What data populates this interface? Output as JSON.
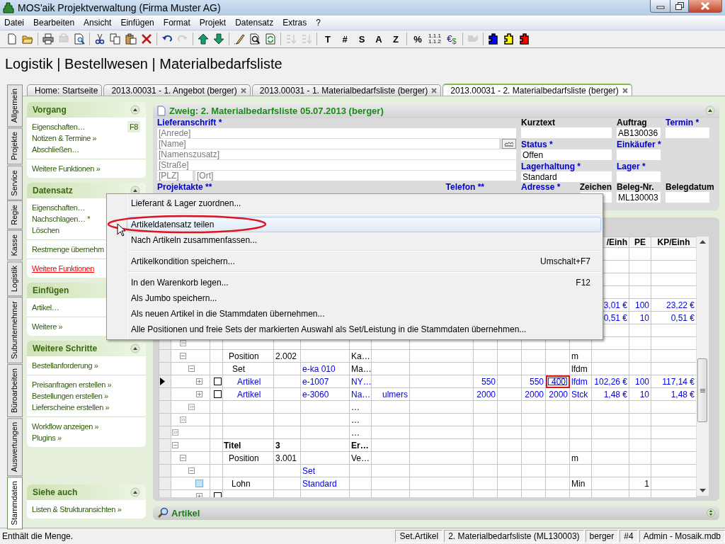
{
  "window": {
    "title": "MOS'aik Projektverwaltung (Firma Muster AG)"
  },
  "menu": [
    "Datei",
    "Bearbeiten",
    "Ansicht",
    "Einfügen",
    "Format",
    "Projekt",
    "Datensatz",
    "Extras",
    "?"
  ],
  "toolbar": [
    [
      {
        "kind": "icon",
        "disabled": false
      },
      {
        "kind": "icon",
        "disabled": false
      }
    ],
    [
      {
        "kind": "icon",
        "disabled": false
      },
      {
        "kind": "icon",
        "disabled": true
      },
      {
        "kind": "icon",
        "disabled": false
      }
    ],
    [
      {
        "kind": "icon",
        "disabled": false
      },
      {
        "kind": "icon",
        "disabled": false
      },
      {
        "kind": "icon",
        "disabled": false
      },
      {
        "kind": "icon",
        "disabled": false
      }
    ],
    [
      {
        "kind": "icon",
        "disabled": false
      },
      {
        "kind": "icon",
        "disabled": true
      }
    ],
    [
      {
        "kind": "icon",
        "disabled": false
      },
      {
        "kind": "icon",
        "disabled": false
      }
    ],
    [
      {
        "kind": "icon",
        "disabled": false
      },
      {
        "kind": "icon",
        "disabled": false
      },
      {
        "kind": "icon",
        "disabled": false
      }
    ],
    [
      {
        "kind": "icon",
        "disabled": true
      },
      {
        "kind": "icon",
        "disabled": true
      }
    ],
    [
      {
        "kind": "text",
        "label": "T"
      },
      {
        "kind": "text",
        "label": "#"
      },
      {
        "kind": "text",
        "label": "S"
      },
      {
        "kind": "text",
        "label": "A"
      },
      {
        "kind": "text",
        "label": "Z"
      }
    ],
    [
      {
        "kind": "text",
        "label": "%"
      },
      {
        "kind": "numbering",
        "lines": [
          "1.1.1",
          "1.1.2"
        ]
      },
      {
        "kind": "currency",
        "symbols": [
          "€",
          "$"
        ]
      }
    ],
    [
      {
        "kind": "icon",
        "disabled": true
      }
    ],
    [
      {
        "kind": "puzzle",
        "color": "#0000ff"
      },
      {
        "kind": "puzzle",
        "color": "#ffff00"
      },
      {
        "kind": "puzzle",
        "color": "#ff0000"
      }
    ]
  ],
  "breadcrumb": "Logistik | Bestellwesen | Materialbedarfsliste",
  "vertical_tabs": [
    {
      "label": "Allgemein",
      "selected": false
    },
    {
      "label": "Projekte",
      "selected": false
    },
    {
      "label": "Service",
      "selected": false
    },
    {
      "label": "Regie",
      "selected": false
    },
    {
      "label": "Kasse",
      "selected": false
    },
    {
      "label": "Logistik",
      "selected": false
    },
    {
      "label": "Subunternehmer",
      "selected": false
    },
    {
      "label": "Büroarbeiten",
      "selected": false
    },
    {
      "label": "Auswertungen",
      "selected": false
    },
    {
      "label": "Stammdaten",
      "selected": true
    }
  ],
  "document_tabs": [
    {
      "label": "Home: Startseite",
      "closable": false,
      "selected": false
    },
    {
      "label": "2013.00031 - 1. Angebot (berger)",
      "closable": true,
      "selected": false
    },
    {
      "label": "2013.00031 - 1. Materialbedarfsliste (berger)",
      "closable": true,
      "selected": false
    },
    {
      "label": "2013.00031 - 2. Materialbedarfsliste (berger)",
      "closable": true,
      "selected": true
    }
  ],
  "sidebar": [
    {
      "title": "Vorgang",
      "expanded": true,
      "groups": [
        [
          {
            "label": "Eigenschaften…",
            "shortcut": "F8",
            "hovered": false
          },
          {
            "label": "Notizen & Termine »",
            "hovered": false
          },
          {
            "label": "Abschließen…",
            "hovered": false
          }
        ],
        [
          {
            "label": "Weitere Funktionen »",
            "hovered": false
          }
        ]
      ]
    },
    {
      "title": "Datensatz",
      "expanded": true,
      "groups": [
        [
          {
            "label": "Eigenschaften…",
            "hovered": false
          },
          {
            "label": "Nachschlagen… *",
            "hovered": false
          },
          {
            "label": "Löschen",
            "hovered": false
          }
        ],
        [
          {
            "label": "Restmenge übernehm",
            "hovered": false
          }
        ],
        [
          {
            "label": "Weitere Funktionen",
            "hovered": true
          }
        ]
      ]
    },
    {
      "title": "Einfügen",
      "groups": [
        [
          {
            "label": "Artikel…",
            "hovered": false
          }
        ],
        [
          {
            "label": "Weitere »",
            "hovered": false
          }
        ]
      ]
    },
    {
      "title": "Weitere Schritte",
      "expanded": true,
      "groups": [
        [
          {
            "label": "Bestellanforderung »",
            "hovered": false
          }
        ],
        [
          {
            "label": "Preisanfragen erstellen »",
            "hovered": false
          },
          {
            "label": "Bestellungen erstellen »",
            "hovered": false
          },
          {
            "label": "Lieferscheine erstellen »",
            "hovered": false
          }
        ],
        [
          {
            "label": "Workflow anzeigen »",
            "hovered": false
          },
          {
            "label": "Plugins »",
            "hovered": false
          }
        ]
      ]
    },
    {
      "title": "Siehe auch",
      "expanded": true,
      "groups": [
        [
          {
            "label": "Listen & Strukturansichten »",
            "hovered": false
          }
        ]
      ]
    }
  ],
  "zweig": {
    "title": "Zweig: 2. Materialbedarfsliste 05.07.2013 (berger)",
    "expanded": true,
    "address_label": {
      "label": "Lieferanschrift *",
      "required": true
    },
    "address_fields": [
      {
        "kind": "line",
        "placeholder": "[Anrede]"
      },
      {
        "kind": "with_button",
        "placeholder": "[Name]"
      },
      {
        "kind": "line",
        "placeholder": "[Namenszusatz]"
      },
      {
        "kind": "line",
        "placeholder": "[Straße]"
      },
      {
        "kind": "pair",
        "placeholders": [
          "[PLZ]",
          "[Ort]"
        ]
      }
    ],
    "columns": [
      [
        {
          "label": "Kurztext",
          "required": false
        },
        {
          "label": "Status *",
          "required": true,
          "value": "Offen"
        },
        {
          "label": "Lagerhaltung *",
          "required": true,
          "value": "Standard"
        }
      ],
      [
        {
          "label": "Auftrag",
          "required": false,
          "value": "AB130036"
        },
        {
          "label": "Einkäufer *",
          "required": true
        },
        {
          "label": "Lager *",
          "required": true
        }
      ],
      [
        {
          "label": "Termin *",
          "required": true
        }
      ]
    ],
    "bottom_fields": [
      {
        "label": "Projektakte **",
        "required": true,
        "kind": "label"
      },
      {
        "label": "Telefon **",
        "required": true,
        "kind": "label"
      },
      {
        "label": "Adresse *",
        "required": true,
        "kind": "label"
      },
      {
        "label": "Zeichen",
        "required": false,
        "kind": "input"
      },
      {
        "label": "Beleg-Nr.",
        "required": false,
        "kind": "input",
        "value": "ML130003"
      },
      {
        "label": "Belegdatum",
        "required": false,
        "kind": "input"
      }
    ]
  },
  "table": {
    "columns": [
      null,
      null,
      null,
      null,
      null,
      null,
      null,
      null,
      null,
      null,
      null,
      "/Einh",
      "PE",
      "KP/Einh"
    ],
    "rows": [
      {
        "kind": "hidden"
      },
      {
        "kind": "hidden"
      },
      {
        "kind": "hidden"
      },
      {
        "kind": "hidden"
      },
      {
        "kind": "article",
        "cells": [
          null,
          null,
          null,
          null,
          null,
          null,
          null,
          null,
          null,
          null,
          null,
          "3,01 €",
          "100",
          "23,22 €"
        ]
      },
      {
        "kind": "article",
        "cells": [
          null,
          null,
          null,
          null,
          null,
          null,
          null,
          null,
          null,
          null,
          null,
          "0,51 €",
          "10",
          "0,51 €"
        ]
      },
      {
        "kind": "hidden",
        "children": [
          {
            "kind": "more"
          },
          {
            "kind": "position",
            "expanded": true,
            "cells": [
              "Position",
              "2.002",
              null,
              "Ka…",
              null,
              null,
              null,
              null,
              null,
              null,
              "m",
              null,
              null,
              null
            ],
            "children": [
              {
                "kind": "set",
                "expanded": true,
                "cells": [
                  "Set",
                  null,
                  "e-ka 010",
                  "Ma…",
                  null,
                  null,
                  null,
                  null,
                  null,
                  null,
                  "lfdm",
                  null,
                  null,
                  null
                ],
                "children": [
                  {
                    "kind": "article",
                    "expanded": false,
                    "checked": false,
                    "current": true,
                    "cells": [
                      "Artikel",
                      null,
                      "e-1007",
                      "NY…",
                      null,
                      null,
                      "550",
                      null,
                      "550",
                      {
                        "text": "400",
                        "editing": true
                      },
                      "lfdm",
                      "102,26 €",
                      "100",
                      "117,14 €"
                    ]
                  },
                  {
                    "kind": "article",
                    "expanded": false,
                    "checked": false,
                    "current": false,
                    "cells": [
                      "Artikel",
                      null,
                      "e-3060",
                      "Na…",
                      "ulmers",
                      null,
                      "2000",
                      null,
                      "2000",
                      "2000",
                      "Stck",
                      "1,48 €",
                      "10",
                      "1,48 €"
                    ]
                  }
                ]
              },
              {
                "kind": "more",
                "cells": [
                  null,
                  null,
                  null,
                  "…",
                  null,
                  null,
                  null,
                  null,
                  null,
                  null,
                  null,
                  null,
                  null,
                  null
                ]
              }
            ]
          },
          {
            "kind": "more",
            "cells": [
              null,
              null,
              null,
              "…",
              null,
              null,
              null,
              null,
              null,
              null,
              null,
              null,
              null,
              null
            ]
          }
        ]
      },
      {
        "kind": "more",
        "cells": [
          null,
          null,
          null,
          "…",
          null,
          null,
          null,
          null,
          null,
          null,
          null,
          null,
          null,
          null
        ]
      },
      {
        "kind": "title",
        "expanded": true,
        "cells": [
          "Titel",
          "3",
          null,
          "Er…",
          null,
          null,
          null,
          null,
          null,
          null,
          null,
          null,
          null,
          null
        ],
        "children": [
          {
            "kind": "position",
            "expanded": true,
            "cells": [
              "Position",
              "3.001",
              null,
              "Ve…",
              null,
              null,
              null,
              null,
              null,
              null,
              "m",
              null,
              null,
              null
            ],
            "children": [
              {
                "kind": "set",
                "expanded": true,
                "cells": [
                  null,
                  null,
                  "Set",
                  null,
                  null,
                  null,
                  null,
                  null,
                  null,
                  null,
                  null,
                  null,
                  null,
                  null
                ],
                "children": [
                  {
                    "kind": "wage",
                    "cells": [
                      "Lohn",
                      null,
                      "Standard",
                      null,
                      null,
                      null,
                      null,
                      null,
                      null,
                      null,
                      "Min",
                      null,
                      "1",
                      null
                    ]
                  },
                  {
                    "kind": "article",
                    "expanded": false,
                    "checked": false
                  }
                ]
              }
            ]
          }
        ]
      }
    ]
  },
  "context_menu": [
    {
      "kind": "item",
      "label": "Lieferant & Lager zuordnen...",
      "highlighted": false
    },
    {
      "kind": "separator"
    },
    {
      "kind": "item",
      "label": "Artikeldatensatz teilen",
      "highlighted": true
    },
    {
      "kind": "item",
      "label": "Nach Artikeln zusammenfassen...",
      "highlighted": false
    },
    {
      "kind": "separator"
    },
    {
      "kind": "item",
      "label": "Artikelkondition speichern...",
      "shortcut": "Umschalt+F7",
      "highlighted": false
    },
    {
      "kind": "separator"
    },
    {
      "kind": "item",
      "label": "In den Warenkorb legen...",
      "shortcut": "F12",
      "highlighted": false
    },
    {
      "kind": "item",
      "label": "Als Jumbo speichern...",
      "highlighted": false
    },
    {
      "kind": "item",
      "label": "Als neuen Artikel in die Stammdaten übernehmen...",
      "highlighted": false
    },
    {
      "kind": "item",
      "label": "Alle Positionen und freie Sets der markierten Auswahl als Set/Leistung in die Stammdaten übernehmen...",
      "highlighted": false
    }
  ],
  "article_bar": {
    "title": "Artikel"
  },
  "status_bar": {
    "message": "Enthält die Menge.",
    "panels": [
      "Set.Artikel",
      "2. Materialbedarfsliste (ML130003)",
      "berger",
      "#4",
      "Admin - Mosaik.mdb"
    ]
  }
}
